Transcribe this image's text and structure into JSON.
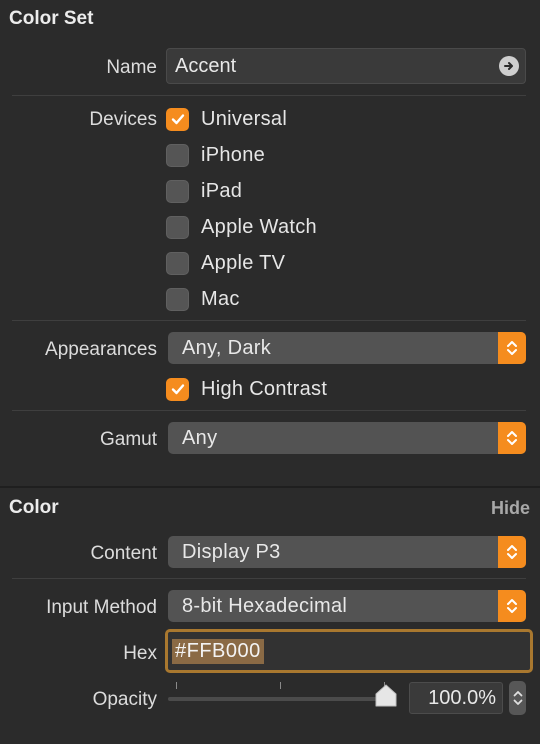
{
  "color_set": {
    "title": "Color Set",
    "name_label": "Name",
    "name_value": "Accent",
    "devices_label": "Devices",
    "devices": [
      {
        "label": "Universal",
        "checked": true
      },
      {
        "label": "iPhone",
        "checked": false
      },
      {
        "label": "iPad",
        "checked": false
      },
      {
        "label": "Apple Watch",
        "checked": false
      },
      {
        "label": "Apple TV",
        "checked": false
      },
      {
        "label": "Mac",
        "checked": false
      }
    ],
    "appearances_label": "Appearances",
    "appearances_value": "Any, Dark",
    "high_contrast_label": "High Contrast",
    "high_contrast_checked": true,
    "gamut_label": "Gamut",
    "gamut_value": "Any"
  },
  "color": {
    "title": "Color",
    "hide_label": "Hide",
    "content_label": "Content",
    "content_value": "Display P3",
    "input_method_label": "Input Method",
    "input_method_value": "8-bit Hexadecimal",
    "hex_label": "Hex",
    "hex_value": "#FFB000",
    "opacity_label": "Opacity",
    "opacity_value": "100.0%",
    "opacity_fraction": 1.0
  },
  "colors": {
    "accent": "#f58c1e",
    "background": "#2b2b2b",
    "focus_ring": "#a9782f"
  },
  "icons": {
    "name_go": "arrow-right-circle-icon",
    "checkmark": "checkmark-icon",
    "popup_stepper": "chevron-up-down-icon"
  }
}
